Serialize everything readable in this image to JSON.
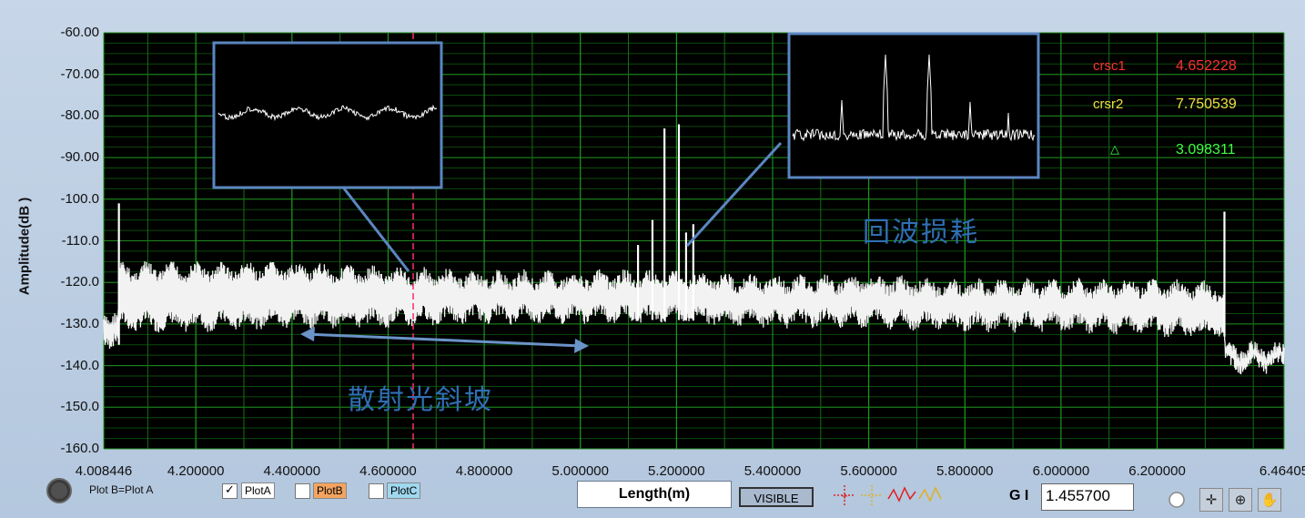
{
  "chart_data": {
    "type": "line",
    "ylabel": "Amplitude(dB )",
    "xlabel": "Length(m)",
    "xlim": [
      4.008446,
      6.46405
    ],
    "ylim": [
      -160,
      -60
    ],
    "x_ticks": [
      "4.008446",
      "4.200000",
      "4.400000",
      "4.600000",
      "4.800000",
      "5.000000",
      "5.200000",
      "5.400000",
      "5.600000",
      "5.800000",
      "6.000000",
      "6.200000",
      "6.46405"
    ],
    "x_tick_values": [
      4.008446,
      4.2,
      4.4,
      4.6,
      4.8,
      5.0,
      5.2,
      5.4,
      5.6,
      5.8,
      6.0,
      6.2,
      6.46405
    ],
    "y_ticks": [
      "-60.00",
      "-70.00",
      "-80.00",
      "-90.00",
      "-100.0",
      "-110.0",
      "-120.0",
      "-130.0",
      "-140.0",
      "-150.0",
      "-160.0"
    ],
    "y_tick_values": [
      -60,
      -70,
      -80,
      -90,
      -100,
      -110,
      -120,
      -130,
      -140,
      -150,
      -160
    ],
    "grid": true,
    "series": [
      {
        "name": "PlotA",
        "color": "#f2f2f2",
        "envelope": [
          {
            "x": 4.008446,
            "low": -135,
            "high": -127
          },
          {
            "x": 4.04,
            "low": -135,
            "high": -127
          },
          {
            "x": 4.041,
            "low": -131,
            "high": -116
          },
          {
            "x": 4.2,
            "low": -131,
            "high": -116
          },
          {
            "x": 4.4,
            "low": -130,
            "high": -116
          },
          {
            "x": 4.6,
            "low": -130,
            "high": -117
          },
          {
            "x": 4.8,
            "low": -129,
            "high": -118
          },
          {
            "x": 5.0,
            "low": -129,
            "high": -118
          },
          {
            "x": 5.2,
            "low": -129,
            "high": -118
          },
          {
            "x": 5.4,
            "low": -130,
            "high": -119
          },
          {
            "x": 5.6,
            "low": -130,
            "high": -119
          },
          {
            "x": 5.8,
            "low": -131,
            "high": -120
          },
          {
            "x": 6.0,
            "low": -131,
            "high": -120
          },
          {
            "x": 6.2,
            "low": -132,
            "high": -120
          },
          {
            "x": 6.34,
            "low": -133,
            "high": -121
          },
          {
            "x": 6.341,
            "low": -141,
            "high": -135
          },
          {
            "x": 6.46405,
            "low": -141,
            "high": -135
          }
        ],
        "peaks": [
          {
            "x": 4.04,
            "y": -101
          },
          {
            "x": 5.12,
            "y": -111
          },
          {
            "x": 5.15,
            "y": -105
          },
          {
            "x": 5.175,
            "y": -83
          },
          {
            "x": 5.205,
            "y": -82
          },
          {
            "x": 5.22,
            "y": -108
          },
          {
            "x": 5.235,
            "y": -106
          },
          {
            "x": 6.34,
            "y": -103
          }
        ]
      }
    ],
    "cursor": {
      "x": 4.652228,
      "color": "#ff2a6d"
    },
    "annotations": {
      "scatter_slope": "散射光斜坡",
      "return_loss": "回波损耗"
    }
  },
  "cursors": [
    {
      "name": "crsc1",
      "value": "4.652228",
      "color": "#ff3030"
    },
    {
      "name": "crsr2",
      "value": "7.750539",
      "color": "#f0e040"
    },
    {
      "name": "△",
      "value": "3.098311",
      "color": "#40ff40"
    }
  ],
  "legend": {
    "plotb_eq": "Plot B=Plot A",
    "items": [
      {
        "label": "PlotA",
        "checked": true,
        "bg": "#ffffff"
      },
      {
        "label": "PlotB",
        "checked": false,
        "bg": "#f4a460"
      },
      {
        "label": "PlotC",
        "checked": false,
        "bg": "#9fd8ef"
      }
    ]
  },
  "controls": {
    "length_label": "Length(m)",
    "visible_label": "VISIBLE",
    "gi_label": "G I",
    "gi_value": "1.455700"
  },
  "tool_icons": [
    "crosshair-icon",
    "zoom-icon",
    "pan-hand-icon"
  ]
}
